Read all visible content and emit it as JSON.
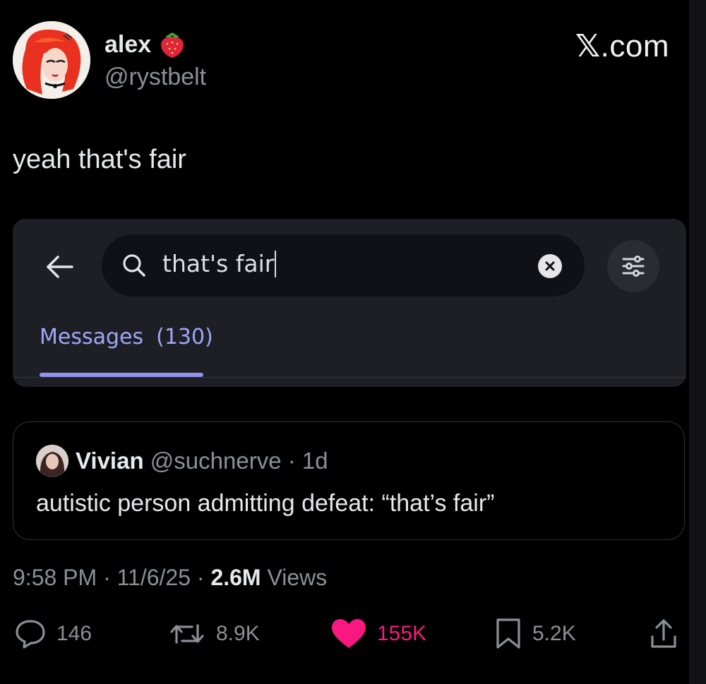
{
  "author": {
    "display_name": "alex",
    "name_emoji": "strawberry-icon",
    "handle": "@rystbelt"
  },
  "brand": {
    "watermark_x": "𝕏",
    "watermark_rest": ".com"
  },
  "tweet": {
    "text": "yeah that's fair"
  },
  "embedded_screenshot": {
    "search": {
      "value": "that's fair",
      "icon": "search-icon"
    },
    "tab": {
      "label": "Messages",
      "count": "(130)"
    },
    "accent_color": "#8d93ef"
  },
  "quoted_tweet": {
    "name": "Vivian",
    "handle": "@suchnerve",
    "separator": " · ",
    "age": "1d",
    "text": "autistic person admitting defeat: “that’s fair”"
  },
  "meta": {
    "time": "9:58 PM",
    "date": "11/6/25",
    "sep": " · ",
    "views_count": "2.6M",
    "views_label": " Views"
  },
  "actions": {
    "replies": "146",
    "reposts": "8.9K",
    "likes": "155K",
    "bookmarks": "5.2K"
  },
  "colors": {
    "background": "#000000",
    "like": "#f91880",
    "muted": "#8b9096"
  }
}
